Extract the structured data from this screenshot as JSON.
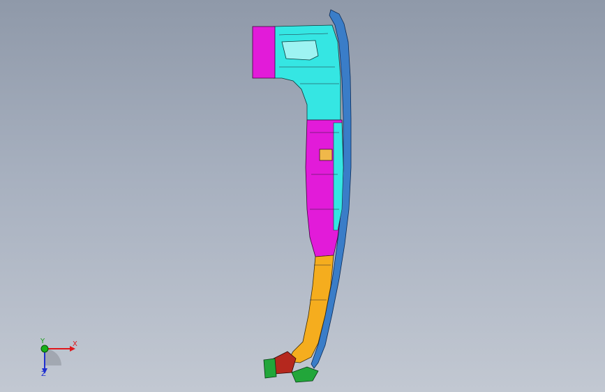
{
  "viewport": {
    "background_top": "#8f99a9",
    "background_bottom": "#c2c8d2"
  },
  "model": {
    "part_colors": {
      "cyan": "#35e6e3",
      "magenta": "#e21bd9",
      "orange": "#f5ad1e",
      "blue_flange": "#3a7dc8",
      "green": "#22a63a",
      "red": "#b5281e"
    }
  },
  "triad": {
    "x_label": "X",
    "y_label": "Y",
    "z_label": "Z"
  }
}
